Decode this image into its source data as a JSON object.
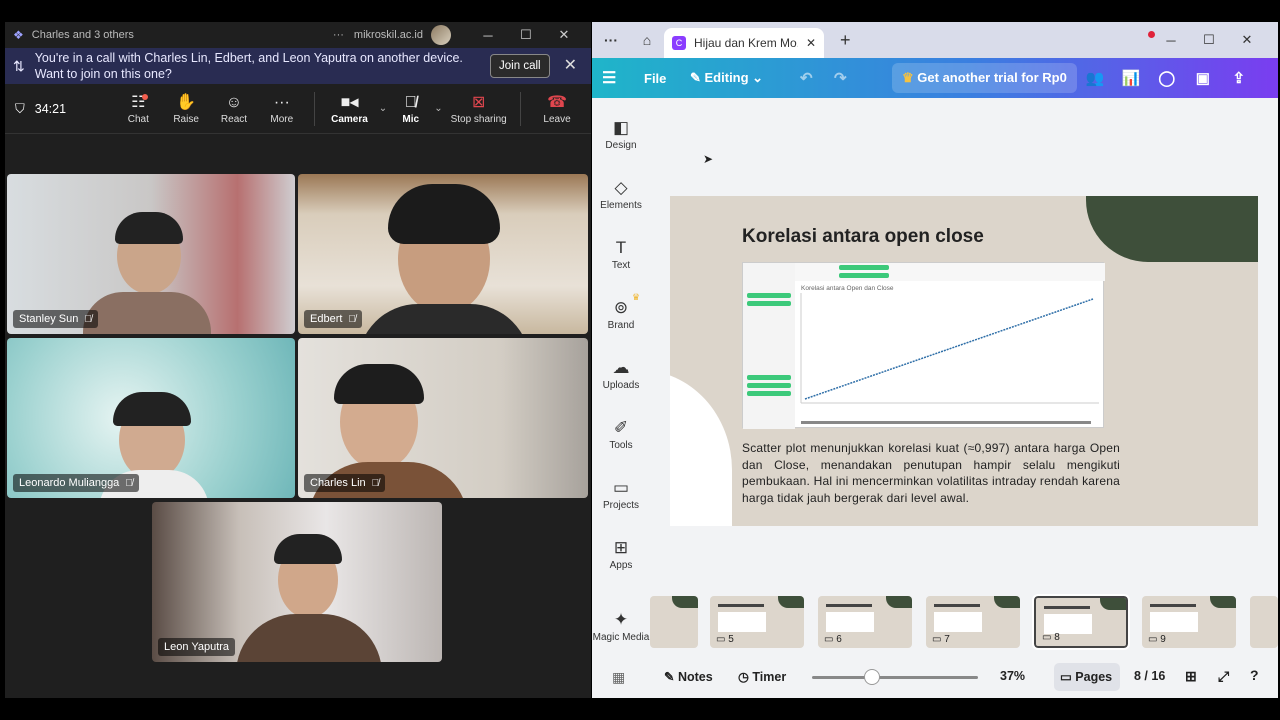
{
  "teams": {
    "title": "Charles and 3 others",
    "domain": "mikroskil.ac.id",
    "banner_text": "You're in a call with Charles Lin, Edbert, and Leon Yaputra on another device. Want to join on this one?",
    "join_label": "Join call",
    "timer": "34:21",
    "toolbar": {
      "chat": "Chat",
      "raise": "Raise",
      "react": "React",
      "more": "More",
      "camera": "Camera",
      "mic": "Mic",
      "stop_sharing": "Stop sharing",
      "leave": "Leave"
    },
    "participants": [
      "Stanley Sun",
      "Edbert",
      "Leonardo Muliangga",
      "Charles Lin",
      "Leon Yaputra"
    ]
  },
  "canva": {
    "tab_title": "Hijau dan Krem Mo...",
    "menu": {
      "file": "File",
      "editing": "Editing",
      "trial": "Get another trial for Rp0"
    },
    "sidebar": [
      "Design",
      "Elements",
      "Text",
      "Brand",
      "Uploads",
      "Tools",
      "Projects",
      "Apps",
      "Magic Media"
    ],
    "slide": {
      "title": "Korelasi antara open close",
      "chart_title": "Korelasi antara Open dan Close",
      "description": "Scatter plot menunjukkan korelasi kuat (≈0,997) antara harga Open dan Close, menandakan penutupan hampir selalu mengikuti pembukaan. Hal ini mencerminkan volatilitas intraday rendah karena harga tidak jauh bergerak dari level awal."
    },
    "thumbnails": [
      "5",
      "6",
      "7",
      "8",
      "9"
    ],
    "bottom": {
      "notes": "Notes",
      "timer": "Timer",
      "zoom": "37%",
      "pages": "Pages",
      "page_count": "8 / 16"
    }
  },
  "colors": {
    "teams_bg": "#1f1f1f",
    "banner_bg": "#292c52",
    "leave_red": "#e0464e",
    "canva_gradient_start": "#1fb5c9",
    "canva_gradient_end": "#7a3df0",
    "slide_bg": "#dcd5cb",
    "slide_accent": "#3e4f3a"
  }
}
